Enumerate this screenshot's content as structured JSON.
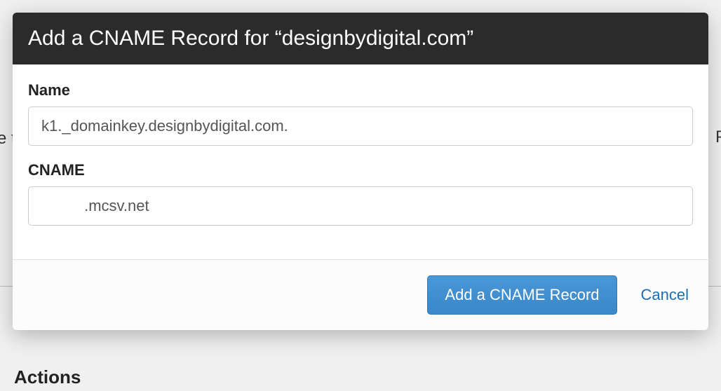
{
  "modal": {
    "title": "Add a CNAME Record for “designbydigital.com”",
    "name_label": "Name",
    "name_value": "k1._domainkey.designbydigital.com.",
    "cname_label": "CNAME",
    "cname_value": "          .mcsv.net",
    "submit_label": "Add a CNAME Record",
    "cancel_label": "Cancel"
  },
  "background": {
    "left_fragment": "re\nth",
    "right_fragment": "P",
    "actions_heading": "Actions"
  }
}
